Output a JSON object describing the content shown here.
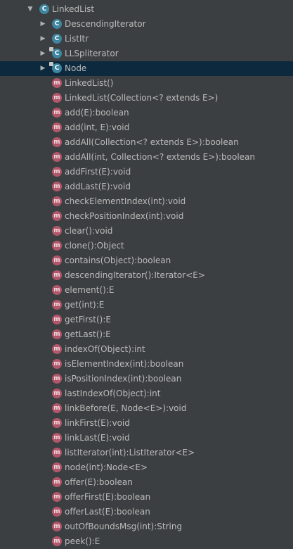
{
  "tree": {
    "root": {
      "label": "LinkedList",
      "icon": "class-icon",
      "expanded": true
    },
    "inner_classes": [
      {
        "label": "DescendingIterator",
        "icon": "class-icon",
        "expanded": false
      },
      {
        "label": "ListItr",
        "icon": "class-icon",
        "expanded": false
      },
      {
        "label": "LLSpliterator",
        "icon": "class-icon",
        "expanded": false
      },
      {
        "label": "Node",
        "icon": "class-icon",
        "expanded": false,
        "selected": true
      }
    ],
    "methods": [
      {
        "label": "LinkedList()"
      },
      {
        "label": "LinkedList(Collection<? extends E>)"
      },
      {
        "label": "add(E):boolean"
      },
      {
        "label": "add(int, E):void"
      },
      {
        "label": "addAll(Collection<? extends E>):boolean"
      },
      {
        "label": "addAll(int, Collection<? extends E>):boolean"
      },
      {
        "label": "addFirst(E):void"
      },
      {
        "label": "addLast(E):void"
      },
      {
        "label": "checkElementIndex(int):void"
      },
      {
        "label": "checkPositionIndex(int):void"
      },
      {
        "label": "clear():void"
      },
      {
        "label": "clone():Object"
      },
      {
        "label": "contains(Object):boolean"
      },
      {
        "label": "descendingIterator():Iterator<E>"
      },
      {
        "label": "element():E"
      },
      {
        "label": "get(int):E"
      },
      {
        "label": "getFirst():E"
      },
      {
        "label": "getLast():E"
      },
      {
        "label": "indexOf(Object):int"
      },
      {
        "label": "isElementIndex(int):boolean"
      },
      {
        "label": "isPositionIndex(int):boolean"
      },
      {
        "label": "lastIndexOf(Object):int"
      },
      {
        "label": "linkBefore(E, Node<E>):void"
      },
      {
        "label": "linkFirst(E):void"
      },
      {
        "label": "linkLast(E):void"
      },
      {
        "label": "listIterator(int):ListIterator<E>"
      },
      {
        "label": "node(int):Node<E>"
      },
      {
        "label": "offer(E):boolean"
      },
      {
        "label": "offerFirst(E):boolean"
      },
      {
        "label": "offerLast(E):boolean"
      },
      {
        "label": "outOfBoundsMsg(int):String"
      },
      {
        "label": "peek():E"
      }
    ],
    "icon_letters": {
      "class": "C",
      "method": "m"
    }
  },
  "colors": {
    "background": "#3c3f41",
    "selection": "#0d293e",
    "text": "#bbbbbb",
    "class_icon": "#3e86a0",
    "method_icon": "#b0576a"
  }
}
